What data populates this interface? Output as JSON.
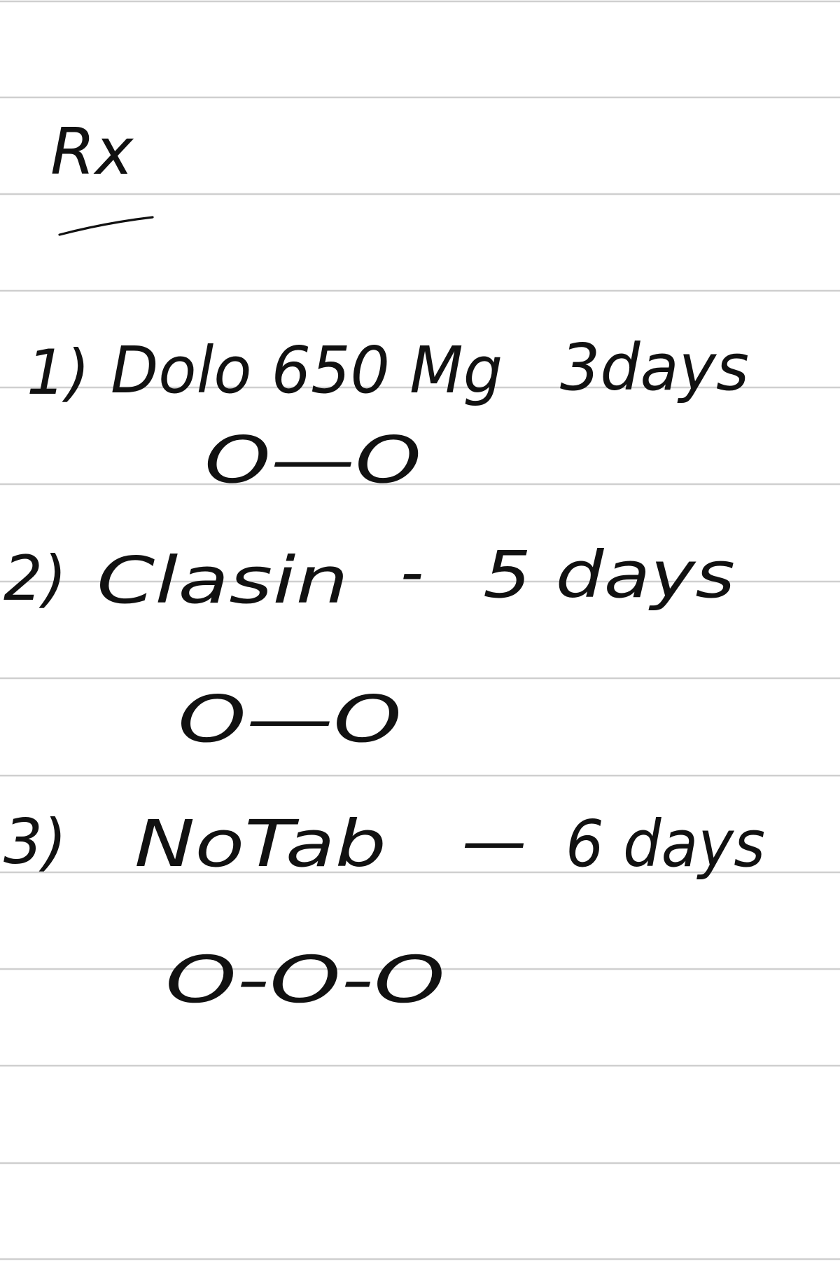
{
  "note": {
    "header": "Rx",
    "items": [
      {
        "number": "1)",
        "drug": "Dolo 650 Mg",
        "separator": "",
        "duration": "3days",
        "dosage": "O—O"
      },
      {
        "number": "2)",
        "drug": "Clasin",
        "separator": "-",
        "duration": "5 days",
        "dosage": "O—O"
      },
      {
        "number": "3)",
        "drug": "NoTab",
        "separator": "—",
        "duration": "6 days",
        "dosage": "O-O-O"
      }
    ]
  },
  "colors": {
    "ink": "#111111",
    "rule_line": "#cfcfcf",
    "paper": "#ffffff"
  }
}
